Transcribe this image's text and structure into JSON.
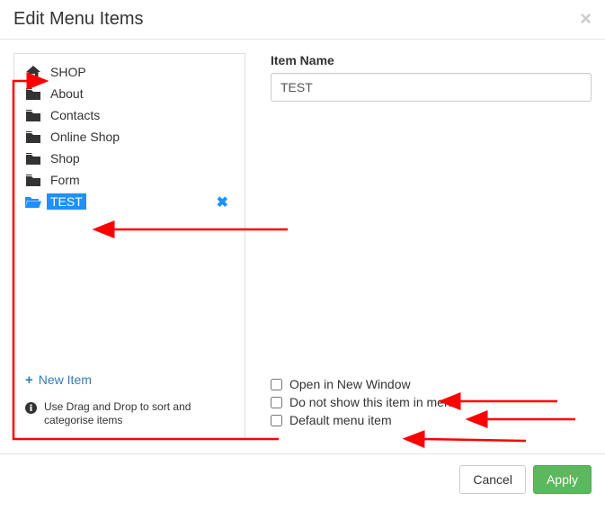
{
  "modal": {
    "title": "Edit Menu Items",
    "close_label": "×"
  },
  "tree": {
    "items": [
      {
        "label": "SHOP",
        "icon": "home-icon",
        "selected": false
      },
      {
        "label": "About",
        "icon": "folder-icon",
        "selected": false
      },
      {
        "label": "Contacts",
        "icon": "folder-icon",
        "selected": false
      },
      {
        "label": "Online Shop",
        "icon": "folder-icon",
        "selected": false
      },
      {
        "label": "Shop",
        "icon": "folder-icon",
        "selected": false
      },
      {
        "label": "Form",
        "icon": "folder-icon",
        "selected": false
      },
      {
        "label": "TEST",
        "icon": "folder-open-icon",
        "selected": true
      }
    ],
    "new_item_label": "New Item",
    "hint_text": "Use Drag and Drop to sort and categorise items"
  },
  "form": {
    "item_name_label": "Item Name",
    "item_name_value": "TEST"
  },
  "checkboxes": {
    "open_new_window": {
      "label": "Open in New Window",
      "checked": false
    },
    "do_not_show": {
      "label": "Do not show this item in menu",
      "checked": false
    },
    "default_item": {
      "label": "Default menu item",
      "checked": false
    }
  },
  "footer": {
    "cancel_label": "Cancel",
    "apply_label": "Apply"
  },
  "colors": {
    "accent_blue": "#1e90ff",
    "link_blue": "#337ab7",
    "success_green": "#5cb85c",
    "annotation_red": "#ff0000"
  }
}
